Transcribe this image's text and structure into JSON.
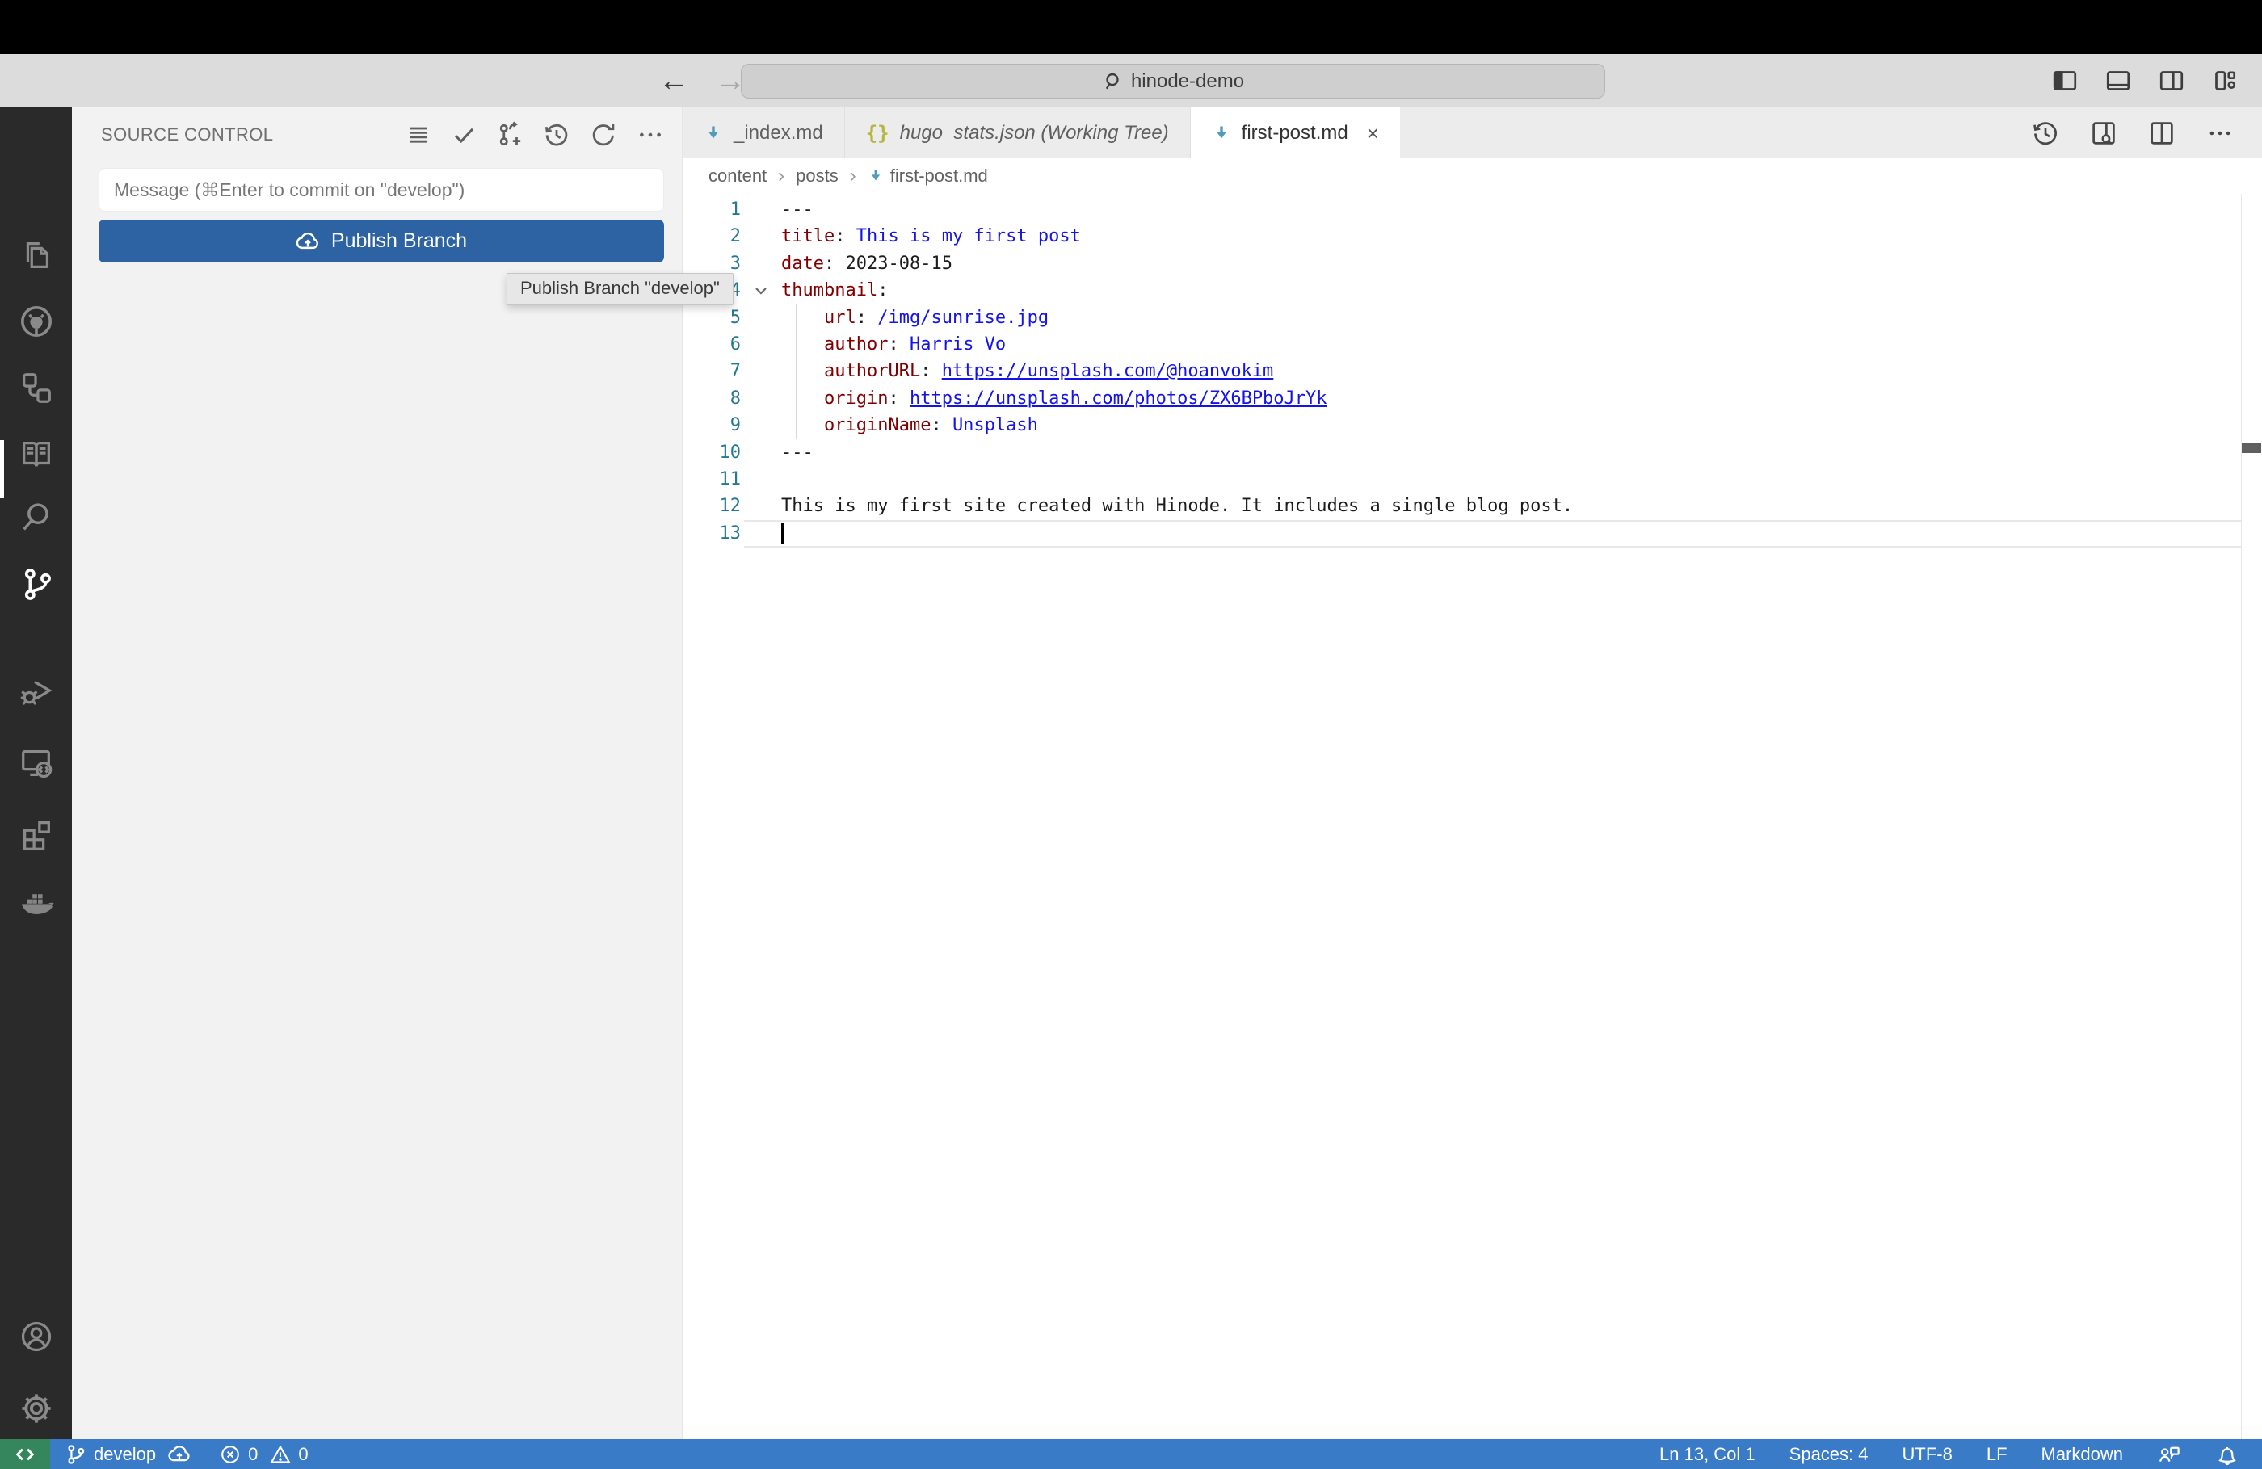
{
  "colors": {
    "publish_button": "#2d62a3",
    "status_bar": "#3a7bc8",
    "remote_green": "#35855d",
    "code_key": "#800000",
    "code_value": "#1414e8",
    "markdown_icon": "#519aba",
    "json_icon": "#b5b53f"
  },
  "titlebar": {
    "search_value": "hinode-demo",
    "icons": [
      "toggle-primary-sidebar",
      "toggle-panel",
      "toggle-secondary-sidebar",
      "customize-layout"
    ]
  },
  "activity_bar": {
    "items": [
      "explorer",
      "github",
      "references",
      "docs",
      "search",
      "source-control",
      "run-and-debug",
      "remote-explorer",
      "extensions",
      "docker"
    ],
    "active_item": "source-control",
    "bottom_items": [
      "accounts",
      "settings"
    ]
  },
  "sidebar": {
    "title": "SOURCE CONTROL",
    "actions": [
      "view-as-list",
      "commit",
      "create-branch",
      "history",
      "refresh",
      "more-actions"
    ],
    "message_placeholder": "Message (⌘Enter to commit on \"develop\")",
    "publish_label": "Publish Branch"
  },
  "tooltip": {
    "text": "Publish Branch \"develop\""
  },
  "editor": {
    "tabs": [
      {
        "label": "_index.md",
        "icon": "markdown",
        "active": false
      },
      {
        "label": "hugo_stats.json (Working Tree)",
        "icon": "json",
        "active": false,
        "italic": true
      },
      {
        "label": "first-post.md",
        "icon": "markdown",
        "active": true,
        "closable": true
      }
    ],
    "actions": [
      "timeline",
      "open-preview-to-side",
      "split-editor",
      "more-actions"
    ],
    "breadcrumb": {
      "folder1": "content",
      "folder2": "posts",
      "file": "first-post.md"
    },
    "cursor_line": 13,
    "lines": [
      {
        "n": 1,
        "tokens": [
          [
            "plain",
            "---"
          ]
        ]
      },
      {
        "n": 2,
        "tokens": [
          [
            "key",
            "title"
          ],
          [
            "punc",
            ": "
          ],
          [
            "val",
            "This is my first post"
          ]
        ]
      },
      {
        "n": 3,
        "tokens": [
          [
            "key",
            "date"
          ],
          [
            "punc",
            ": "
          ],
          [
            "plain",
            "2023-08-15"
          ]
        ]
      },
      {
        "n": 4,
        "fold": true,
        "tokens": [
          [
            "key",
            "thumbnail"
          ],
          [
            "punc",
            ":"
          ]
        ]
      },
      {
        "n": 5,
        "tokens": [
          [
            "plain",
            "    "
          ],
          [
            "key",
            "url"
          ],
          [
            "punc",
            ": "
          ],
          [
            "val",
            "/img/sunrise.jpg"
          ]
        ]
      },
      {
        "n": 6,
        "tokens": [
          [
            "plain",
            "    "
          ],
          [
            "key",
            "author"
          ],
          [
            "punc",
            ": "
          ],
          [
            "val",
            "Harris Vo"
          ]
        ]
      },
      {
        "n": 7,
        "tokens": [
          [
            "plain",
            "    "
          ],
          [
            "key",
            "authorURL"
          ],
          [
            "punc",
            ": "
          ],
          [
            "link",
            "https://unsplash.com/@hoanvokim"
          ]
        ]
      },
      {
        "n": 8,
        "tokens": [
          [
            "plain",
            "    "
          ],
          [
            "key",
            "origin"
          ],
          [
            "punc",
            ": "
          ],
          [
            "link",
            "https://unsplash.com/photos/ZX6BPboJrYk"
          ]
        ]
      },
      {
        "n": 9,
        "tokens": [
          [
            "plain",
            "    "
          ],
          [
            "key",
            "originName"
          ],
          [
            "punc",
            ": "
          ],
          [
            "val",
            "Unsplash"
          ]
        ]
      },
      {
        "n": 10,
        "tokens": [
          [
            "plain",
            "---"
          ]
        ]
      },
      {
        "n": 11,
        "tokens": []
      },
      {
        "n": 12,
        "tokens": [
          [
            "plain",
            "This is my first site created with Hinode. It includes a single blog post."
          ]
        ]
      },
      {
        "n": 13,
        "tokens": [],
        "cursor": true
      }
    ]
  },
  "status_bar": {
    "branch": "develop",
    "errors": "0",
    "warnings": "0",
    "line_col": "Ln 13, Col 1",
    "indentation": "Spaces: 4",
    "encoding": "UTF-8",
    "eol": "LF",
    "language": "Markdown"
  }
}
